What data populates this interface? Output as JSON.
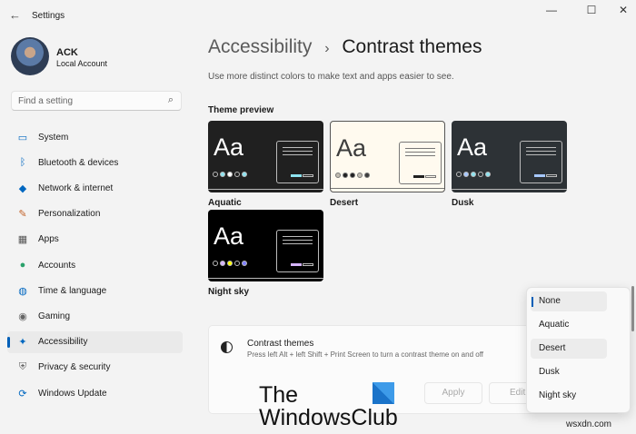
{
  "window": {
    "title": "Settings",
    "back_icon": "arrow-left-icon"
  },
  "user": {
    "name": "ACK",
    "account": "Local Account"
  },
  "search": {
    "placeholder": "Find a setting"
  },
  "sidebar": {
    "items": [
      {
        "label": "System",
        "icon": "monitor-icon",
        "color": "#0067c0"
      },
      {
        "label": "Bluetooth & devices",
        "icon": "bluetooth-icon",
        "color": "#0067c0"
      },
      {
        "label": "Network & internet",
        "icon": "wifi-icon",
        "color": "#0067c0"
      },
      {
        "label": "Personalization",
        "icon": "brush-icon",
        "color": "#c2632a"
      },
      {
        "label": "Apps",
        "icon": "apps-icon",
        "color": "#555"
      },
      {
        "label": "Accounts",
        "icon": "person-icon",
        "color": "#2aa16b"
      },
      {
        "label": "Time & language",
        "icon": "globe-clock-icon",
        "color": "#0067c0"
      },
      {
        "label": "Gaming",
        "icon": "gamepad-icon",
        "color": "#666"
      },
      {
        "label": "Accessibility",
        "icon": "accessibility-icon",
        "color": "#0067c0",
        "selected": true
      },
      {
        "label": "Privacy & security",
        "icon": "shield-icon",
        "color": "#666"
      },
      {
        "label": "Windows Update",
        "icon": "update-icon",
        "color": "#0067c0"
      }
    ]
  },
  "main": {
    "breadcrumb_parent": "Accessibility",
    "breadcrumb_sep": "›",
    "title": "Contrast themes",
    "subtitle": "Use more distinct colors to make text and apps easier to see.",
    "preview_heading": "Theme preview",
    "themes": [
      {
        "name": "Aquatic",
        "sample": "Aa",
        "bg": "#202020",
        "fg": "#ffffff",
        "dots": [
          "#202020",
          "#8ee3f0",
          "#ffffff",
          "#202020",
          "#8ee3f0"
        ],
        "accent": "#8ee3f0"
      },
      {
        "name": "Desert",
        "sample": "Aa",
        "bg": "#fffaef",
        "fg": "#3d3d3d",
        "dots": [
          "#c0bbb0",
          "#202020",
          "#202020",
          "#c0bbb0",
          "#3d3d3d"
        ],
        "accent": "#202020"
      },
      {
        "name": "Dusk",
        "sample": "Aa",
        "bg": "#2d3236",
        "fg": "#ffffff",
        "dots": [
          "#2d3236",
          "#a6c8ff",
          "#8ee3f0",
          "#2d3236",
          "#8ee3f0"
        ],
        "accent": "#a6c8ff"
      },
      {
        "name": "Night sky",
        "sample": "Aa",
        "bg": "#000000",
        "fg": "#ffffff",
        "dots": [
          "#000000",
          "#d6b4fd",
          "#ffff00",
          "#000000",
          "#8080ff"
        ],
        "accent": "#d6b4fd"
      }
    ],
    "contrast_card": {
      "heading": "Contrast themes",
      "description": "Press left Alt + left Shift + Print Screen to turn a contrast theme on and off",
      "apply": "Apply",
      "edit": "Edit"
    },
    "dropdown": {
      "options": [
        "None",
        "Aquatic",
        "Desert",
        "Dusk",
        "Night sky"
      ],
      "selected": "None",
      "hovered": "Desert"
    }
  },
  "watermark": {
    "line1": "The",
    "line2": "WindowsClub",
    "site": "wsxdn.com"
  }
}
